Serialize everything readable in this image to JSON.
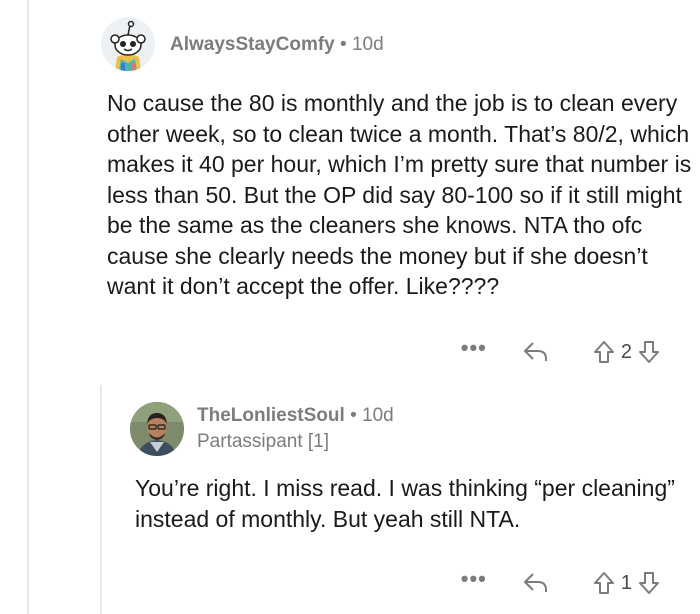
{
  "comments": [
    {
      "username": "AlwaysStayComfy",
      "separator": "•",
      "age": "10d",
      "body": "No cause the 80 is monthly and the job is to clean every other week, so to clean twice a month. That’s 80/2, which makes it 40 per hour, which I’m pretty sure that number is less than 50. But the OP did say 80-100 so if it still might be the same as the cleaners she knows. NTA tho ofc cause she clearly needs the money but if she doesn’t want it don’t accept the offer. Like????",
      "more_label": "•••",
      "vote_count": "2"
    },
    {
      "username": "TheLonliestSoul",
      "separator": "•",
      "age": "10d",
      "flair": "Partassipant [1]",
      "body": "You’re right. I miss read. I was thinking “per cleaning” instead of monthly. But yeah still NTA.",
      "more_label": "•••",
      "vote_count": "1"
    }
  ],
  "colors": {
    "meta_text": "#7c7c7c",
    "body_text": "#1a1a1b",
    "thread_line": "#e8e8e8"
  },
  "icons": [
    "more-options-icon",
    "reply-icon",
    "upvote-icon",
    "downvote-icon"
  ]
}
